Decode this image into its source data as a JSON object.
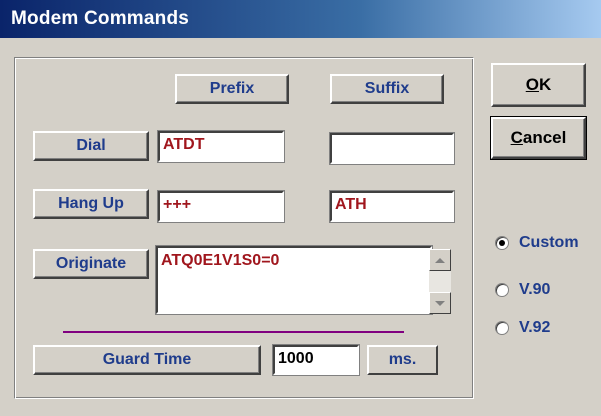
{
  "window": {
    "title": "Modem Commands"
  },
  "buttons": {
    "prefix": "Prefix",
    "suffix": "Suffix",
    "dial": "Dial",
    "hang_up": "Hang Up",
    "originate": "Originate",
    "guard_time": "Guard Time",
    "ok_mnemonic": "O",
    "ok_rest": "K",
    "cancel_mnemonic": "C",
    "cancel_rest": "ancel"
  },
  "fields": {
    "dial_prefix": "ATDT",
    "dial_suffix": "",
    "hangup_prefix": "+++",
    "hangup_suffix": "ATH",
    "originate": "ATQ0E1V1S0=0",
    "guard_time": "1000"
  },
  "units": {
    "guard_time": "ms."
  },
  "radio_options": [
    {
      "label": "Custom",
      "selected": true
    },
    {
      "label": "V.90",
      "selected": false
    },
    {
      "label": "V.92",
      "selected": false
    }
  ],
  "colors": {
    "title_gradient_start": "#0a246a",
    "button_text": "#1f3c8c",
    "field_text": "#a0161d",
    "separator": "#800080",
    "background": "#d4d0c8"
  }
}
